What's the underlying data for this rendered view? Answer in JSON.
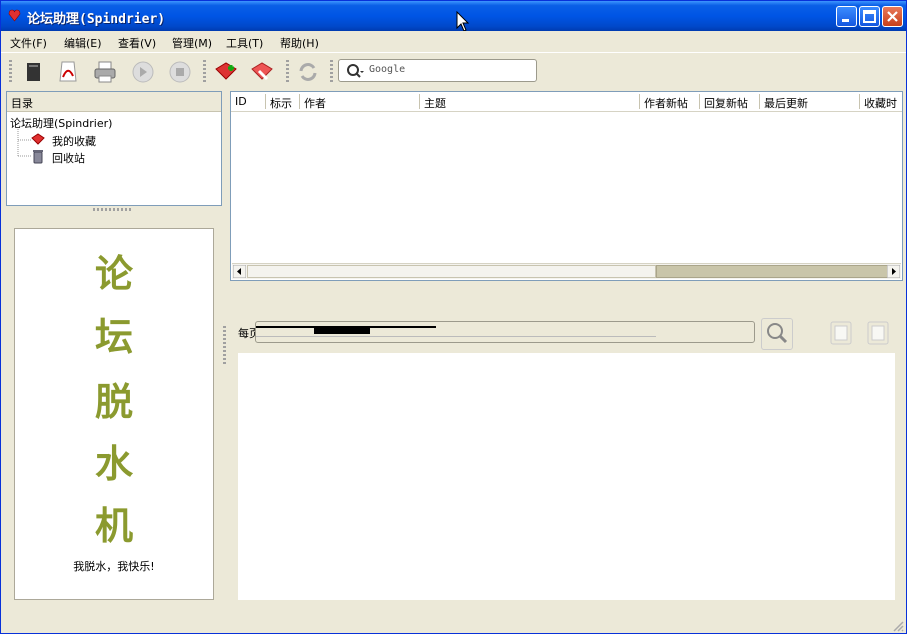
{
  "window": {
    "title": "论坛助理(Spindrier)",
    "brand_color": "#0055e5"
  },
  "menu": [
    {
      "label": "文件(F)"
    },
    {
      "label": "编辑(E)"
    },
    {
      "label": "查看(V)"
    },
    {
      "label": "管理(M)"
    },
    {
      "label": "工具(T)"
    },
    {
      "label": "帮助(H)"
    }
  ],
  "toolbar": {
    "buttons": [
      "book-icon",
      "pdf-icon",
      "print-icon",
      "play-icon",
      "stop-icon",
      "add-favorite-icon",
      "remove-favorite-icon",
      "refresh-icon"
    ],
    "search_placeholder": "Google"
  },
  "tree": {
    "header": "目录",
    "root": "论坛助理(Spindrier)",
    "items": [
      {
        "label": "我的收藏",
        "icon": "favorites-icon"
      },
      {
        "label": "回收站",
        "icon": "recycle-bin-icon"
      }
    ]
  },
  "table": {
    "columns": [
      "ID",
      "标示",
      "作者",
      "主题",
      "作者新帖",
      "回复新帖",
      "最后更新",
      "收藏时"
    ]
  },
  "image_panel": {
    "calligraphy": [
      "论",
      "坛",
      "脱",
      "水",
      "机"
    ],
    "slogan": "我脱水，我快乐!"
  },
  "pager": {
    "label": "每页"
  },
  "colors": {
    "accent": "#8b9a2f",
    "bg": "#ece9d8"
  }
}
